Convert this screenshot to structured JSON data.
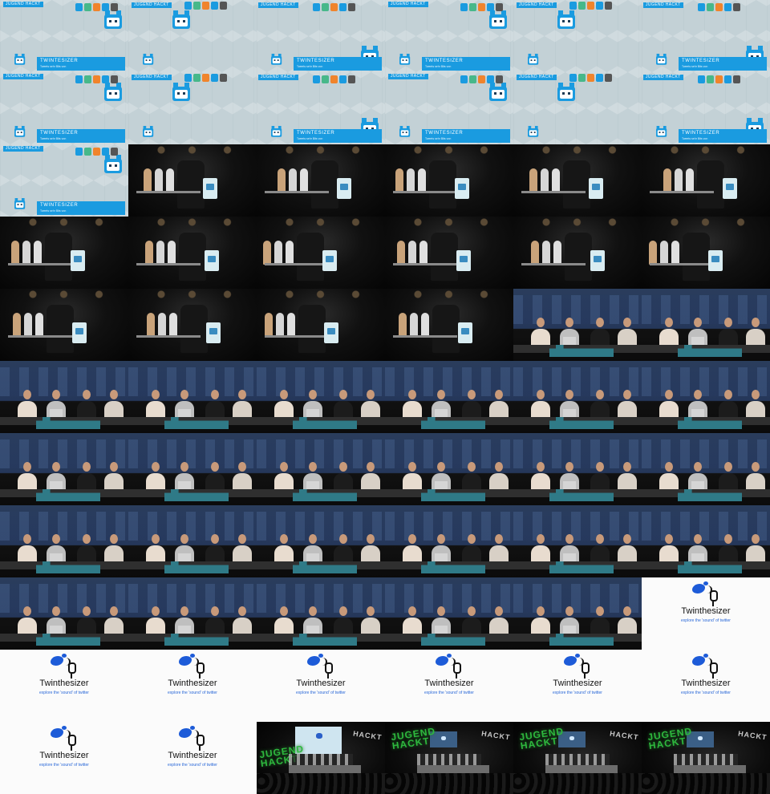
{
  "title_card": {
    "tag": "JUGEND HACKT",
    "banner_title": "TWINTESIZER",
    "banner_sub": "Tweets sehr Bits von",
    "mascot_color": "#1a9be0",
    "bot_colors": [
      "#1a9be0",
      "#47b88a",
      "#f0842c",
      "#1a9be0",
      "#555555"
    ]
  },
  "logo_slide": {
    "name": "Twinthesizer",
    "tagline": "explore the 'sound' of twitter",
    "bird_color": "#1d5bd8"
  },
  "wide_shot": {
    "neon_left": "JUGEND HACKT",
    "neon_right": "HACKT"
  },
  "frames": [
    "title",
    "title",
    "title",
    "title",
    "title",
    "title",
    "title",
    "title",
    "title",
    "title",
    "title",
    "title",
    "title",
    "stage",
    "stage",
    "stage",
    "stage",
    "stage",
    "stage",
    "stage",
    "stage",
    "stage",
    "stage",
    "stage",
    "stage",
    "stage",
    "stage",
    "stage",
    "present",
    "present",
    "present",
    "present",
    "present",
    "present",
    "present",
    "present",
    "present",
    "present",
    "present",
    "present",
    "present",
    "present",
    "present",
    "present",
    "present",
    "present",
    "present",
    "present",
    "present",
    "present",
    "present",
    "present",
    "present",
    "logo",
    "logo",
    "logo",
    "logo",
    "logo",
    "logo",
    "logo",
    "logo",
    "logo",
    "wide",
    "wide",
    "wide",
    "wide"
  ]
}
